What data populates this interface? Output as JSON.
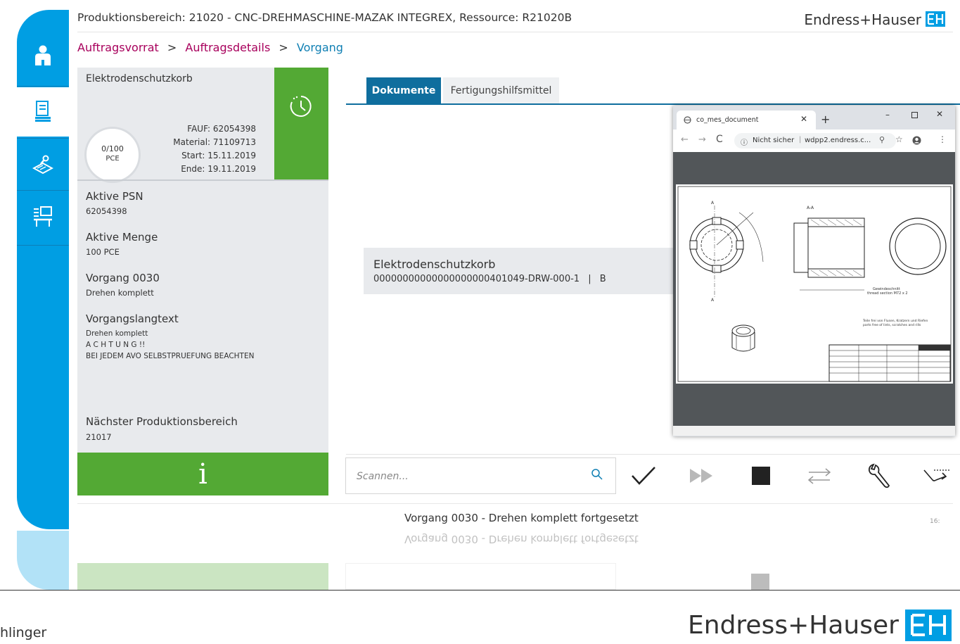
{
  "header": {
    "title": "Produktionsbereich: 21020 - CNC-DREHMASCHINE-MAZAK INTEGREX, Ressource: R21020B",
    "brand": "Endress+Hauser"
  },
  "breadcrumb": {
    "items": [
      "Auftragsvorrat",
      "Auftragsdetails",
      "Vorgang"
    ],
    "separator": ">"
  },
  "sidebar": {
    "items": [
      {
        "icon": "user-icon"
      },
      {
        "icon": "document-stack-icon",
        "active": true
      },
      {
        "icon": "tools-layers-icon"
      },
      {
        "icon": "workstation-icon"
      }
    ]
  },
  "order": {
    "name": "Elektrodenschutzkorb",
    "progress_text": "0/100",
    "progress_unit": "PCE",
    "fauf_label": "FAUF:",
    "fauf": "62054398",
    "material_label": "Material:",
    "material": "71109713",
    "start_label": "Start:",
    "start": "15.11.2019",
    "end_label": "Ende:",
    "end": "19.11.2019",
    "status_icon": "clock-icon",
    "status_color": "#53a934"
  },
  "details": {
    "psn_label": "Aktive PSN",
    "psn": "62054398",
    "menge_label": "Aktive Menge",
    "menge": "100 PCE",
    "vorgang_label": "Vorgang 0030",
    "vorgang": "Drehen komplett",
    "langtext_label": "Vorgangslangtext",
    "langtext_1": "Drehen komplett",
    "langtext_2": "A C H T U N G !!",
    "langtext_3": "BEI JEDEM AVO SELBSTPRUEFUNG BEACHTEN",
    "next_label": "Nächster Produktionsbereich",
    "next": "21017",
    "info_glyph": "i"
  },
  "tabs": [
    {
      "label": "Dokumente",
      "active": true
    },
    {
      "label": "Fertigungshilfsmittel",
      "active": false
    }
  ],
  "document": {
    "title": "Elektrodenschutzkorb",
    "number": "00000000000000000000401049-DRW-000-1",
    "separator": "|",
    "revision": "B"
  },
  "browser": {
    "tab_title": "co_mes_document",
    "security": "Nicht sicher",
    "url": "wdpp2.endress.c...",
    "drawing_labels": {
      "section": "A-A",
      "thread_note": "Gewindeschnitt",
      "thread_note_en": "thread section M72 x 2",
      "surface_note": "Teile frei von Flusen, Kratzern und Riefen",
      "surface_note_en": "parts free of lints, scratches and rills"
    }
  },
  "toolbar": {
    "scan_placeholder": "Scannen...",
    "buttons": [
      "checkmark-icon",
      "fast-forward-icon",
      "stop-icon",
      "swap-icon",
      "wrench-icon",
      "skip-icon"
    ]
  },
  "status": {
    "message": "Vorgang 0030 - Drehen komplett fortgesetzt",
    "time": "16:"
  },
  "footer": {
    "presenter": "hlinger",
    "brand": "Endress+Hauser"
  },
  "colors": {
    "accent_blue": "#009ee3",
    "tab_blue": "#0f6e9e",
    "green": "#53a934",
    "breadcrumb_link": "#a8005c"
  }
}
